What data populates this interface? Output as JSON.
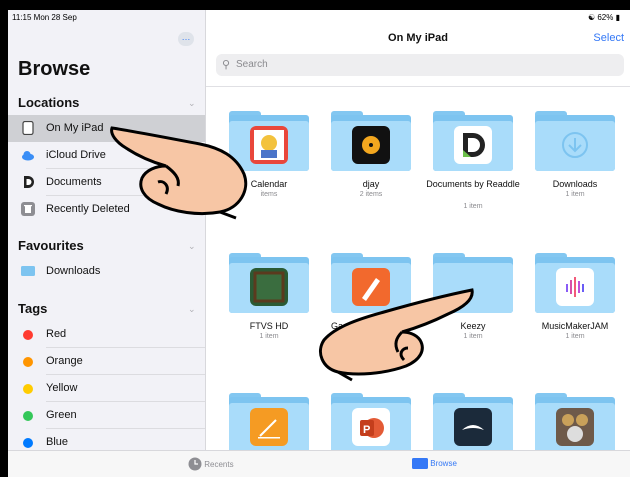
{
  "status": {
    "time": "11:15  Mon 28 Sep",
    "battery": "62%"
  },
  "sidebar": {
    "more": "…",
    "title": "Browse",
    "locations_header": "Locations",
    "locations": [
      {
        "label": "On My iPad",
        "icon": "ipad-icon",
        "selected": true
      },
      {
        "label": "iCloud Drive",
        "icon": "icloud-icon"
      },
      {
        "label": "Documents",
        "icon": "documents-app-icon"
      },
      {
        "label": "Recently Deleted",
        "icon": "trash-icon"
      }
    ],
    "favourites_header": "Favourites",
    "favourites": [
      {
        "label": "Downloads",
        "icon": "folder-icon"
      }
    ],
    "tags_header": "Tags",
    "tags": [
      {
        "label": "Red",
        "color": "#ff3b30"
      },
      {
        "label": "Orange",
        "color": "#ff9500"
      },
      {
        "label": "Yellow",
        "color": "#ffcc00"
      },
      {
        "label": "Green",
        "color": "#34c759"
      },
      {
        "label": "Blue",
        "color": "#007aff"
      }
    ]
  },
  "main": {
    "title": "On My iPad",
    "select": "Select",
    "search_placeholder": "Search",
    "folders": [
      {
        "name": "Calendar",
        "count": "items",
        "app": "calendar-app"
      },
      {
        "name": "djay",
        "count": "2 items",
        "app": "djay-app"
      },
      {
        "name": "Documents by Readdle",
        "count": "1 item",
        "app": "documents-app"
      },
      {
        "name": "Downloads",
        "count": "1 item",
        "app": "download-arrow"
      },
      {
        "name": "FTVS HD",
        "count": "1 item",
        "app": "ftvs-app"
      },
      {
        "name": "Ga",
        "count": "",
        "app": "garageband-app"
      },
      {
        "name": "Keezy",
        "count": "1 item",
        "app": "none"
      },
      {
        "name": "MusicMakerJAM",
        "count": "1 item",
        "app": "musicmaker-app"
      },
      {
        "name": "",
        "count": "",
        "app": "pages-app"
      },
      {
        "name": "",
        "count": "",
        "app": "powerpoint-app"
      },
      {
        "name": "",
        "count": "",
        "app": "bird-app"
      },
      {
        "name": "",
        "count": "",
        "app": "drums-app"
      }
    ]
  },
  "tabbar": {
    "recents": "Recents",
    "browse": "Browse"
  }
}
